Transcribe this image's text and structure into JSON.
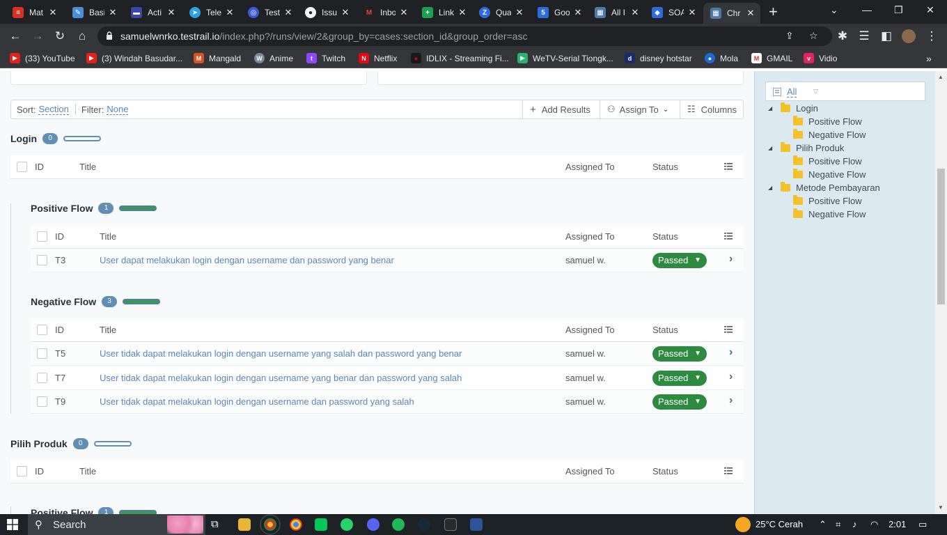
{
  "browser": {
    "tabs": [
      {
        "label": "Mat",
        "color": "#d93025",
        "glyph": "≡"
      },
      {
        "label": "Basi",
        "color": "#4a90d9",
        "glyph": "✎"
      },
      {
        "label": "Acti",
        "color": "#3949ab",
        "glyph": "▬"
      },
      {
        "label": "Tele",
        "color": "#2aa3e0",
        "glyph": "➤"
      },
      {
        "label": "Test",
        "color": "#3a5bd9",
        "glyph": "◎"
      },
      {
        "label": "Issu",
        "color": "#202124",
        "glyph": "●"
      },
      {
        "label": "Inbo",
        "color": "#d93025",
        "glyph": "M"
      },
      {
        "label": "Link",
        "color": "#1e9e50",
        "glyph": "+"
      },
      {
        "label": "Qua",
        "color": "#2d6cdf",
        "glyph": "Z"
      },
      {
        "label": "Goo",
        "color": "#2d6cdf",
        "glyph": "5"
      },
      {
        "label": "All I",
        "color": "#4a7aa8",
        "glyph": "▦"
      },
      {
        "label": "SOA",
        "color": "#2d6cdf",
        "glyph": "◆"
      },
      {
        "label": "Chr",
        "color": "#4a7aa8",
        "glyph": "▦"
      }
    ],
    "url_host": "samuelwnrko.testrail.io",
    "url_path": "/index.php?/runs/view/2&group_by=cases:section_id&group_order=asc",
    "bookmarks": [
      {
        "label": "(33) YouTube",
        "color": "#e62117",
        "glyph": "▶"
      },
      {
        "label": "(3) Windah Basudar...",
        "color": "#e62117",
        "glyph": "▶"
      },
      {
        "label": "Mangald",
        "color": "#d9531e",
        "glyph": "M"
      },
      {
        "label": "Anime",
        "color": "#7a8a9a",
        "glyph": "W"
      },
      {
        "label": "Twitch",
        "color": "#9146ff",
        "glyph": "t"
      },
      {
        "label": "Netflix",
        "color": "#e50914",
        "glyph": "N"
      },
      {
        "label": "IDLIX - Streaming Fi...",
        "color": "#b00000",
        "glyph": "●"
      },
      {
        "label": "WeTV-Serial Tiongk...",
        "color": "#29b36e",
        "glyph": "▶"
      },
      {
        "label": "disney hotstar",
        "color": "#1a2a6c",
        "glyph": "d"
      },
      {
        "label": "Mola",
        "color": "#1a6ccf",
        "glyph": "●"
      },
      {
        "label": "GMAIL",
        "color": "#d93025",
        "glyph": "M"
      },
      {
        "label": "Vidio",
        "color": "#e0245e",
        "glyph": "v"
      }
    ]
  },
  "toolbar": {
    "sort_label": "Sort:",
    "sort_value": "Section",
    "filter_label": "Filter:",
    "filter_value": "None",
    "add_results": "Add Results",
    "assign_to": "Assign To",
    "columns": "Columns"
  },
  "columns": {
    "id": "ID",
    "title": "Title",
    "assigned_to": "Assigned To",
    "status": "Status"
  },
  "sections": [
    {
      "name": "Login",
      "count": "0"
    },
    {
      "name": "Positive Flow",
      "count": "1",
      "rows": [
        {
          "id": "T3",
          "title": "User dapat melakukan login dengan username dan password yang benar",
          "assigned": "samuel w.",
          "status": "Passed"
        }
      ]
    },
    {
      "name": "Negative Flow",
      "count": "3",
      "rows": [
        {
          "id": "T5",
          "title": "User tidak dapat melakukan login dengan username yang salah dan password yang benar",
          "assigned": "samuel w.",
          "status": "Passed"
        },
        {
          "id": "T7",
          "title": "User tidak dapat melakukan login dengan username yang benar dan password yang salah",
          "assigned": "samuel w.",
          "status": "Passed"
        },
        {
          "id": "T9",
          "title": "User tidak dapat melakukan login dengan username dan password yang salah",
          "assigned": "samuel w.",
          "status": "Passed"
        }
      ]
    },
    {
      "name": "Pilih Produk",
      "count": "0"
    },
    {
      "name": "Positive Flow",
      "count": "1"
    }
  ],
  "sidebar": {
    "filter_all": "All",
    "tree": [
      {
        "label": "Login",
        "level": 0
      },
      {
        "label": "Positive Flow",
        "level": 1
      },
      {
        "label": "Negative Flow",
        "level": 1
      },
      {
        "label": "Pilih Produk",
        "level": 0
      },
      {
        "label": "Positive Flow",
        "level": 1
      },
      {
        "label": "Negative Flow",
        "level": 1
      },
      {
        "label": "Metode Pembayaran",
        "level": 0
      },
      {
        "label": "Positive Flow",
        "level": 1
      },
      {
        "label": "Negative Flow",
        "level": 1
      }
    ]
  },
  "taskbar": {
    "search_label": "Search",
    "weather": "25°C  Cerah",
    "time": "2:01"
  },
  "colors": {
    "passed": "#2e8a3e",
    "link": "#5b87b5",
    "badge": "#5f8fb4"
  }
}
